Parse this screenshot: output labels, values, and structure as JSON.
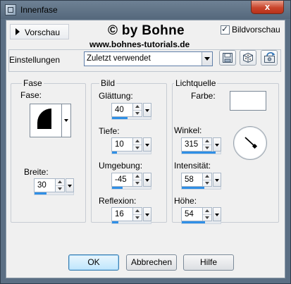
{
  "window": {
    "title": "Innenfase",
    "close_glyph": "x",
    "icon": "app-icon"
  },
  "header": {
    "preview_toggle_label": "Vorschau",
    "watermark_line1": "© by Bohne",
    "watermark_line2": "www.bohnes-tutorials.de",
    "preview_checkbox_label": "Bildvorschau",
    "preview_checked": true,
    "check_glyph": "✓"
  },
  "presets": {
    "label": "Einstellungen",
    "value": "Zuletzt verwendet",
    "buttons": [
      "save-preset-icon",
      "randomize-icon",
      "reset-icon"
    ]
  },
  "groups": {
    "bevel": {
      "title": "Fase",
      "shape_label": "Fase:",
      "width_label": "Breite:",
      "width_value": "30",
      "width_level": 0.3
    },
    "image": {
      "title": "Bild",
      "smoothness_label": "Glättung:",
      "smoothness_value": "40",
      "smoothness_level": 0.4,
      "depth_label": "Tiefe:",
      "depth_value": "10",
      "depth_level": 0.12,
      "ambience_label": "Umgebung:",
      "ambience_value": "-45",
      "ambience_level": 0.28,
      "shininess_label": "Reflexion:",
      "shininess_value": "16",
      "shininess_level": 0.16
    },
    "light": {
      "title": "Lichtquelle",
      "color_label": "Farbe:",
      "color_value": "#ffffff",
      "angle_label": "Winkel:",
      "angle_value": "315",
      "angle_level": 0.87,
      "intensity_label": "Intensität:",
      "intensity_value": "58",
      "intensity_level": 0.58,
      "elevation_label": "Höhe:",
      "elevation_value": "54",
      "elevation_level": 0.6
    }
  },
  "buttons": {
    "ok": "OK",
    "cancel": "Abbrechen",
    "help": "Hilfe"
  },
  "colors": {
    "accent_bar": "#2f8fe6",
    "close_button": "#c9452c",
    "window_chrome": "#5b6f84"
  }
}
